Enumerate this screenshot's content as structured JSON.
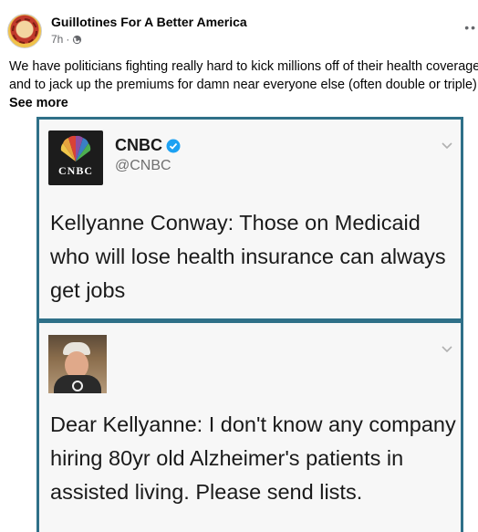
{
  "post": {
    "page_name": "Guillotines For A Better America",
    "timestamp": "7h",
    "separator": "·",
    "body_lines": [
      "We have politicians fighting really hard to kick millions off of their health coverage,",
      "and to jack up the premiums for damn near everyone else (often double or triple)..."
    ],
    "see_more": "See more"
  },
  "image": {
    "tweet1": {
      "logo_text": "CNBC",
      "account_name": "CNBC",
      "handle": "@CNBC",
      "text_lines": [
        "Kellyanne Conway: Those on Medicaid",
        "who will lose health insurance can always",
        "get jobs"
      ]
    },
    "tweet2": {
      "text_lines": [
        "Dear Kellyanne: I don't know any company",
        "hiring 80yr old Alzheimer's patients in",
        "assisted living. Please send lists."
      ]
    },
    "colors": {
      "frame_border": "#2f7088",
      "verified_blue": "#1da1f2",
      "tweet_bg": "#f7f7f7"
    }
  },
  "icons": [
    "page-avatar",
    "globe-icon",
    "more-options-icon",
    "peacock-logo",
    "verified-badge-icon",
    "chevron-down-icon"
  ]
}
